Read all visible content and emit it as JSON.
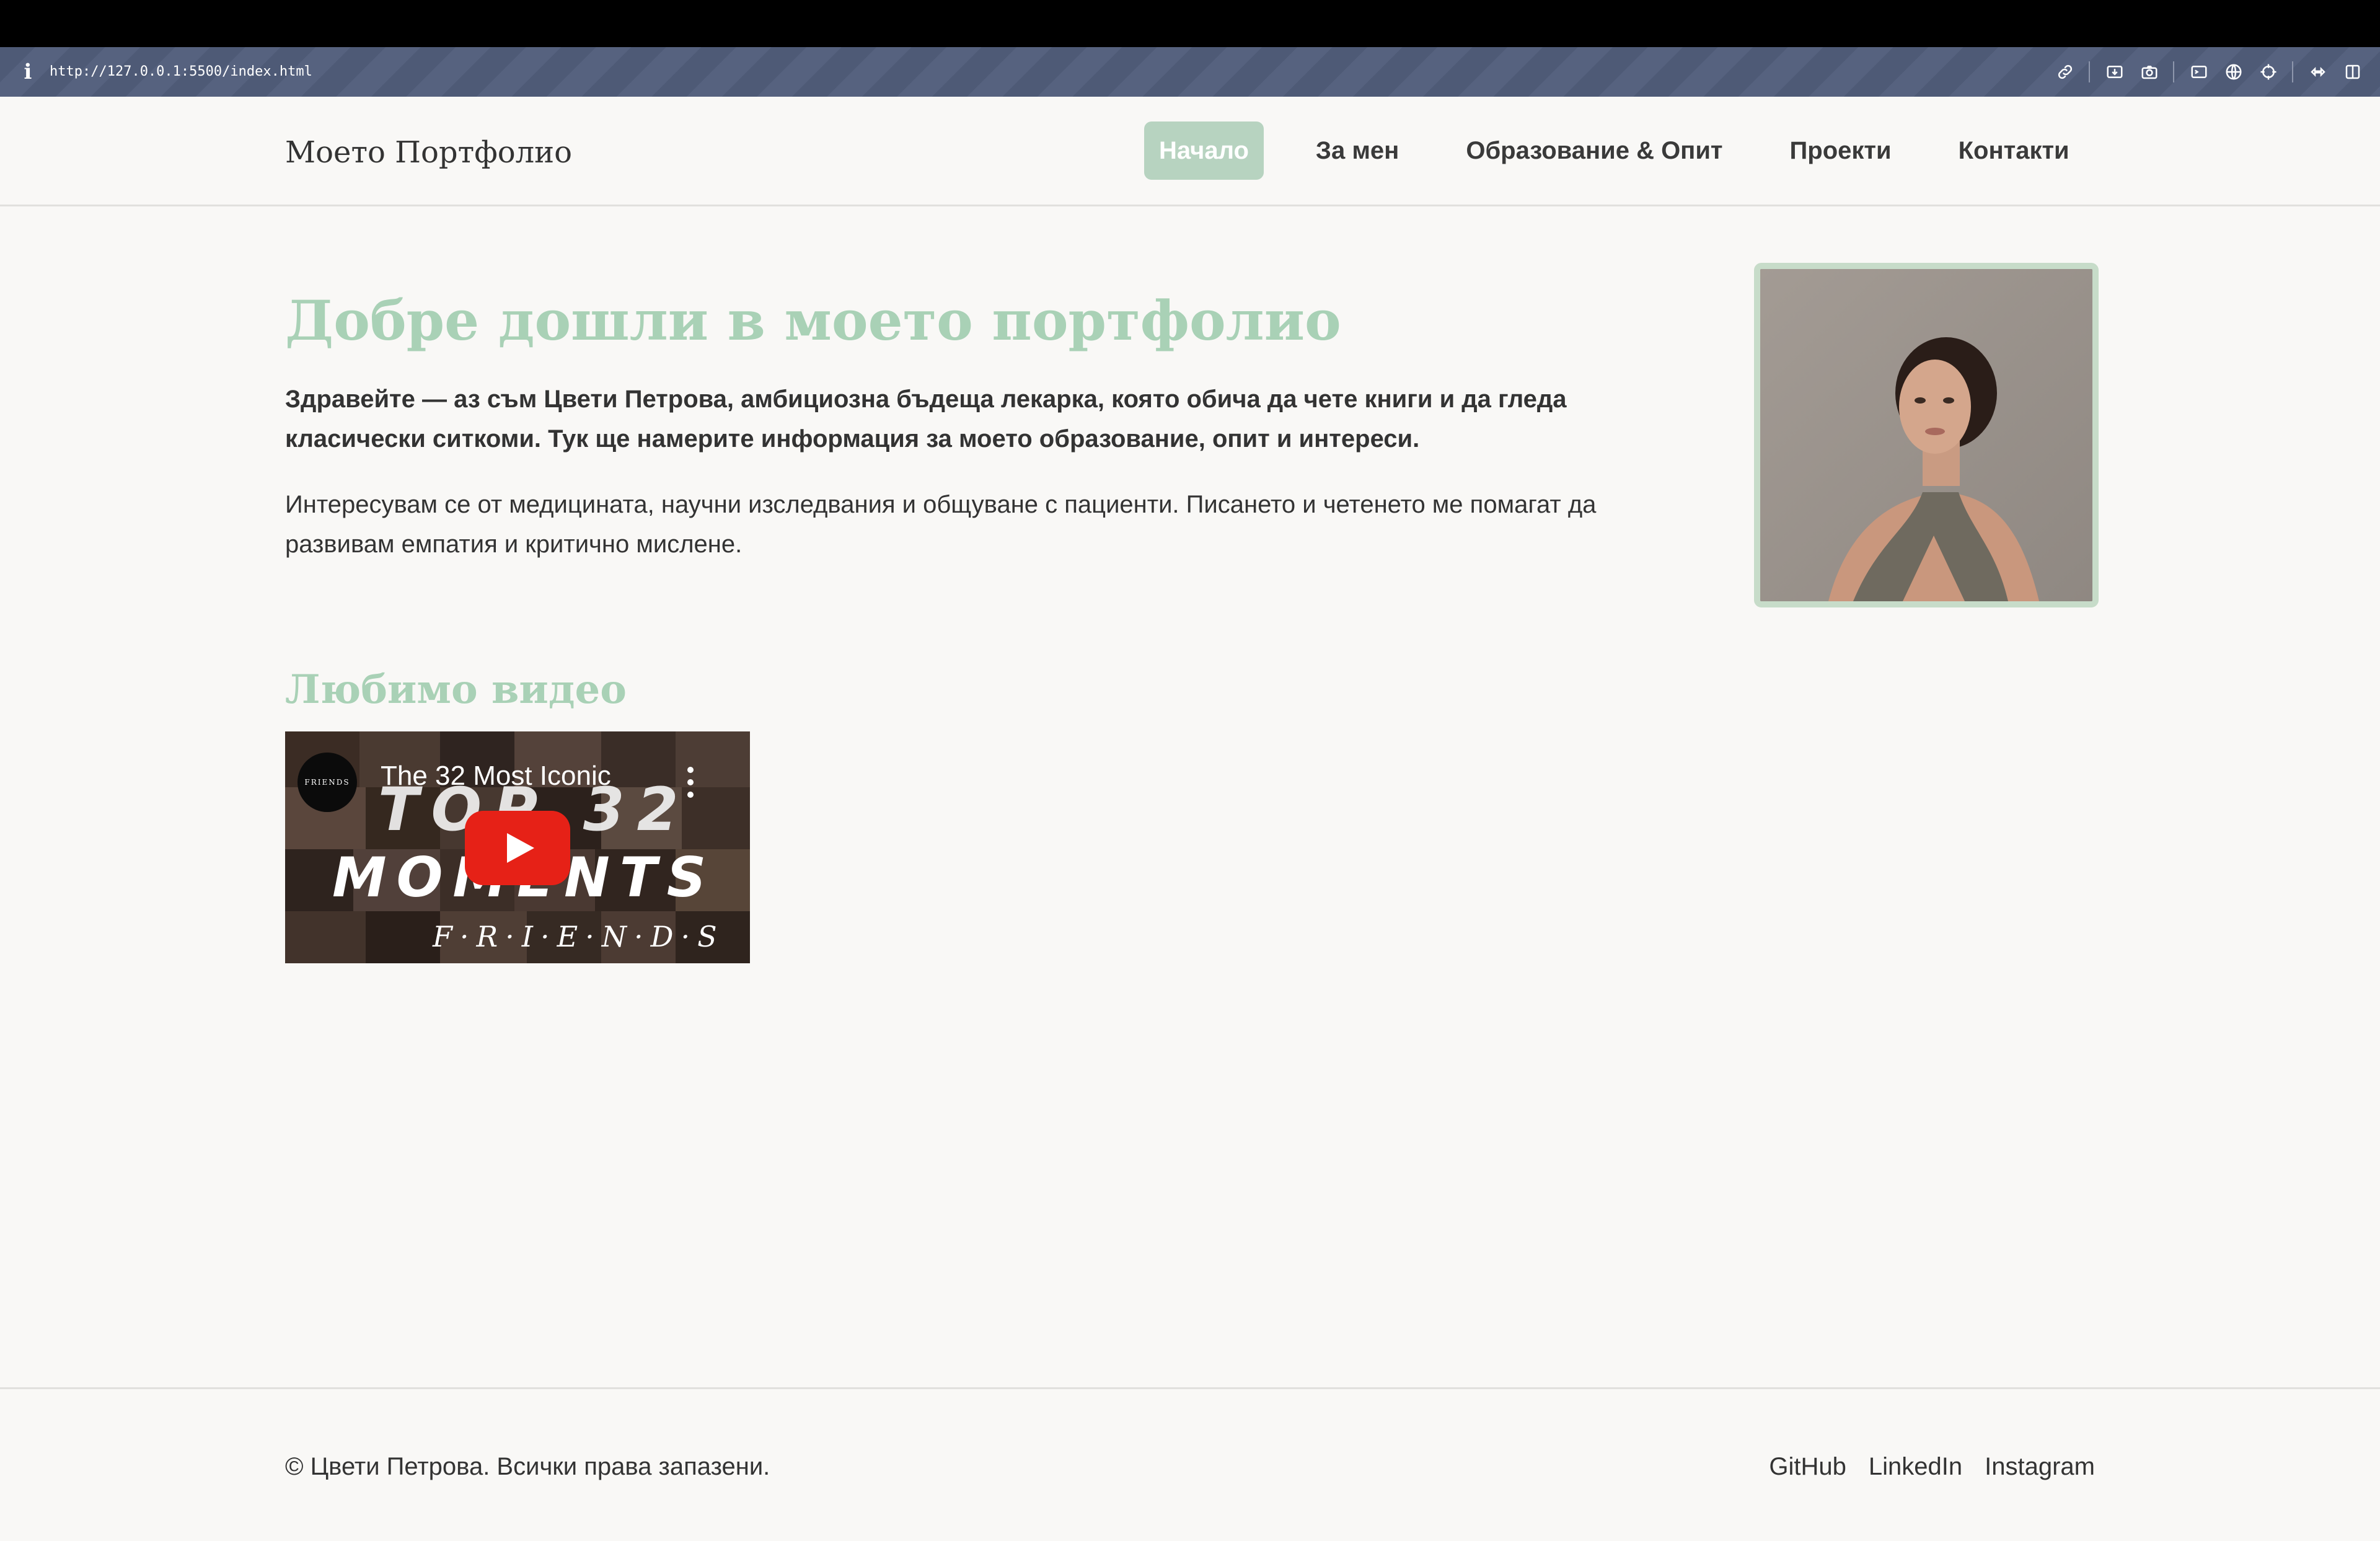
{
  "browser": {
    "url": "http://127.0.0.1:5500/index.html",
    "info_icon": "i",
    "tool_icons": [
      "link-icon",
      "download-icon",
      "camera-icon",
      "terminal-icon",
      "globe-icon",
      "crosshair-icon",
      "extensions-icon",
      "split-view-icon"
    ]
  },
  "header": {
    "brand": "Моето Портфолио",
    "nav": [
      {
        "label": "Начало",
        "active": true
      },
      {
        "label": "За мен",
        "active": false
      },
      {
        "label": "Образование & Опит",
        "active": false
      },
      {
        "label": "Проекти",
        "active": false
      },
      {
        "label": "Контакти",
        "active": false
      }
    ]
  },
  "hero": {
    "title": "Добре дошли в моето портфолио",
    "lead": "Здравейте — аз съм Цвети Петрова, амбициозна бъдеща лекарка, която обича да чете книги и да гледа класически ситкоми. Тук ще намерите информация за моето образование, опит и интереси.",
    "paragraph": "Интересувам се от медицината, научни изследвания и общуване с пациенти. Писането и четенето ме помагат да развивам емпатия и критично мислене."
  },
  "video_section": {
    "title": "Любимо видео",
    "video_title": "The 32 Most Iconic",
    "thumbnail_text_1": "TOP 32",
    "thumbnail_text_2": "MOMENTS",
    "thumbnail_text_3": "F·R·I·E·N·D·S",
    "channel_logo": "FRIENDS"
  },
  "footer": {
    "copyright": "© Цвети Петрова. Всички права запазени.",
    "links": [
      "GitHub",
      "LinkedIn",
      "Instagram"
    ]
  },
  "colors": {
    "accent": "#a9d1b6",
    "nav_active_bg": "#b7d3c0",
    "page_bg": "#f9f8f6",
    "text": "#333333",
    "youtube_red": "#e62117"
  }
}
